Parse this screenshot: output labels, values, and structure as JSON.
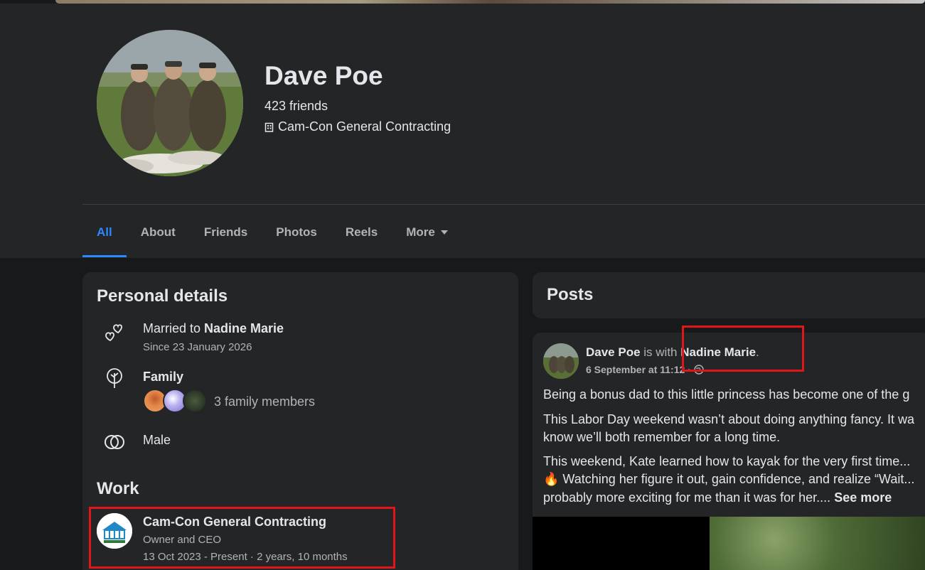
{
  "profile": {
    "name": "Dave Poe",
    "friends": "423 friends",
    "workplace": "Cam-Con General Contracting"
  },
  "tabs": [
    {
      "label": "All",
      "active": true
    },
    {
      "label": "About"
    },
    {
      "label": "Friends"
    },
    {
      "label": "Photos"
    },
    {
      "label": "Reels"
    },
    {
      "label": "More"
    }
  ],
  "personal": {
    "title": "Personal details",
    "relationship_prefix": "Married to ",
    "relationship_partner": "Nadine Marie",
    "relationship_since": "Since 23 January 2026",
    "family_label": "Family",
    "family_count": "3 family members",
    "gender": "Male"
  },
  "work": {
    "title": "Work",
    "company": "Cam-Con General Contracting",
    "role": "Owner and CEO",
    "period": "13 Oct 2023 - Present · 2 years, 10 months"
  },
  "posts": {
    "title": "Posts",
    "post": {
      "author": "Dave Poe",
      "with_text": " is with ",
      "tagged": "Nadine Marie",
      "period_char": ".",
      "date": "6 September at 11:12",
      "line1": "Being a bonus dad to this little princess has become one of the g",
      "line2": "This Labor Day weekend wasn’t about doing anything fancy. It wa",
      "line3": "know we’ll both remember for a long time.",
      "line4": "This weekend, Kate learned how to kayak for the very first time...",
      "line5": "🔥 Watching her figure it out, gain confidence, and realize “Wait...",
      "line6": "probably more exciting for me than it was for her.... ",
      "see_more": "See more"
    }
  },
  "colors": {
    "background": "#18191a",
    "card": "#242526",
    "accent": "#2d88ff",
    "highlight_box": "#e0161b"
  },
  "icons": [
    "building-icon",
    "hearts-icon",
    "family-tree-icon",
    "gender-rings-icon",
    "caret-down-icon",
    "globe-icon"
  ]
}
